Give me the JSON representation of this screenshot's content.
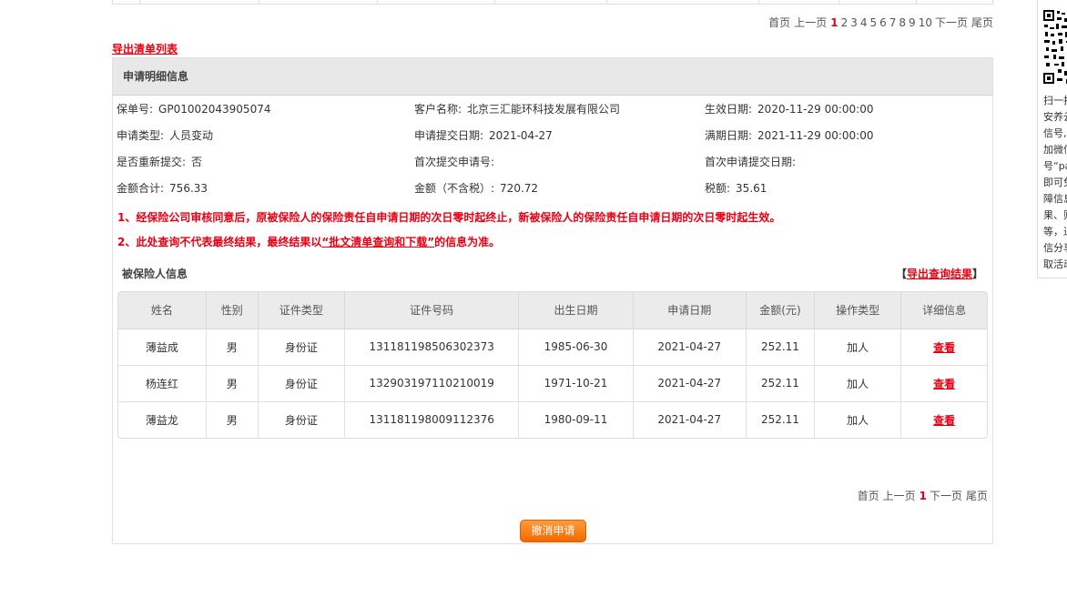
{
  "pager_top": {
    "first": "首页",
    "prev": "上一页",
    "pages": [
      "1",
      "2",
      "3",
      "4",
      "5",
      "6",
      "7",
      "8",
      "9",
      "10"
    ],
    "current": "1",
    "next": "下一页",
    "last": "尾页"
  },
  "export_list_link": "导出清单列表",
  "detail": {
    "header": "申请明细信息",
    "rows": [
      [
        {
          "label": "保单号:",
          "value": "GP01002043905074"
        },
        {
          "label": "客户名称:",
          "value": "北京三汇能环科技发展有限公司"
        },
        {
          "label": "生效日期:",
          "value": "2020-11-29 00:00:00"
        }
      ],
      [
        {
          "label": "申请类型:",
          "value": "人员变动"
        },
        {
          "label": "申请提交日期:",
          "value": "2021-04-27"
        },
        {
          "label": "满期日期:",
          "value": "2021-11-29 00:00:00"
        }
      ],
      [
        {
          "label": "是否重新提交:",
          "value": "否"
        },
        {
          "label": "首次提交申请号:",
          "value": ""
        },
        {
          "label": "首次申请提交日期:",
          "value": ""
        }
      ],
      [
        {
          "label": "金额合计:",
          "value": "756.33"
        },
        {
          "label": "金额（不含税）:",
          "value": "720.72"
        },
        {
          "label": "税额:",
          "value": "35.61"
        }
      ]
    ],
    "notice1": "1、经保险公司审核同意后，原被保险人的保险责任自申请日期的次日零时起终止，新被保险人的保险责任自申请日期的次日零时起生效。",
    "notice2_prefix": "2、此处查询不代表最终结果，最终结果以",
    "notice2_link": "“批文清单查询和下载”",
    "notice2_suffix": "的信息为准。"
  },
  "insured": {
    "title": "被保险人信息",
    "export_open": "【",
    "export_link": "导出查询结果",
    "export_close": "】",
    "columns": [
      "姓名",
      "性别",
      "证件类型",
      "证件号码",
      "出生日期",
      "申请日期",
      "金额(元)",
      "操作类型",
      "详细信息"
    ],
    "rows": [
      [
        "薄益成",
        "男",
        "身份证",
        "131181198506302373",
        "1985-06-30",
        "2021-04-27",
        "252.11",
        "加人",
        "查看"
      ],
      [
        "杨连红",
        "男",
        "身份证",
        "132903197110210019",
        "1971-10-21",
        "2021-04-27",
        "252.11",
        "加人",
        "查看"
      ],
      [
        "薄益龙",
        "男",
        "身份证",
        "131181198009112376",
        "1980-09-11",
        "2021-04-27",
        "252.11",
        "加人",
        "查看"
      ]
    ]
  },
  "pager_bottom": {
    "first": "首页",
    "prev": "上一页",
    "current": "1",
    "next": "下一页",
    "last": "尾页"
  },
  "cancel_button": "撤消申请",
  "side_panel": {
    "lines": [
      "扫一扫",
      "安养云",
      "信号,",
      "加微信",
      "号“pa",
      "即可免",
      "障信息",
      "果、则",
      "等，通",
      "信分享",
      "取活动"
    ]
  },
  "colors": {
    "accent_red": "#e60012",
    "button_orange": "#f26a00",
    "header_gray": "#e8e8e8"
  }
}
